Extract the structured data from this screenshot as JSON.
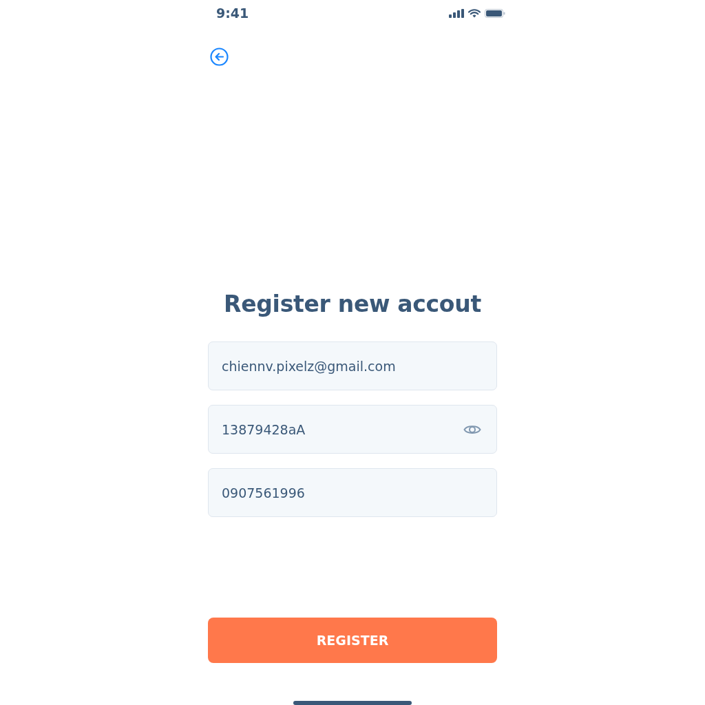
{
  "status_bar": {
    "time": "9:41"
  },
  "title": "Register new accout",
  "fields": [
    {
      "kind": "text",
      "value": "chiennv.pixelz@gmail.com"
    },
    {
      "kind": "password",
      "value": "13879428aA"
    },
    {
      "kind": "text",
      "value": "0907561996"
    }
  ],
  "button": {
    "label": "REGISTER"
  }
}
